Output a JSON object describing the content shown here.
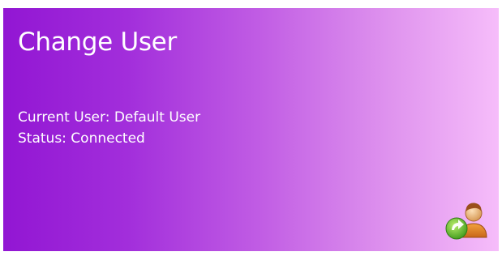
{
  "tile": {
    "title": "Change User",
    "current_user_line": "Current User: Default User",
    "status_line": "Status: Connected",
    "icon": "change-user-icon",
    "colors": {
      "gradient_start": "#9216d3",
      "gradient_end": "#f6bdfa",
      "text": "#ffffff"
    }
  }
}
